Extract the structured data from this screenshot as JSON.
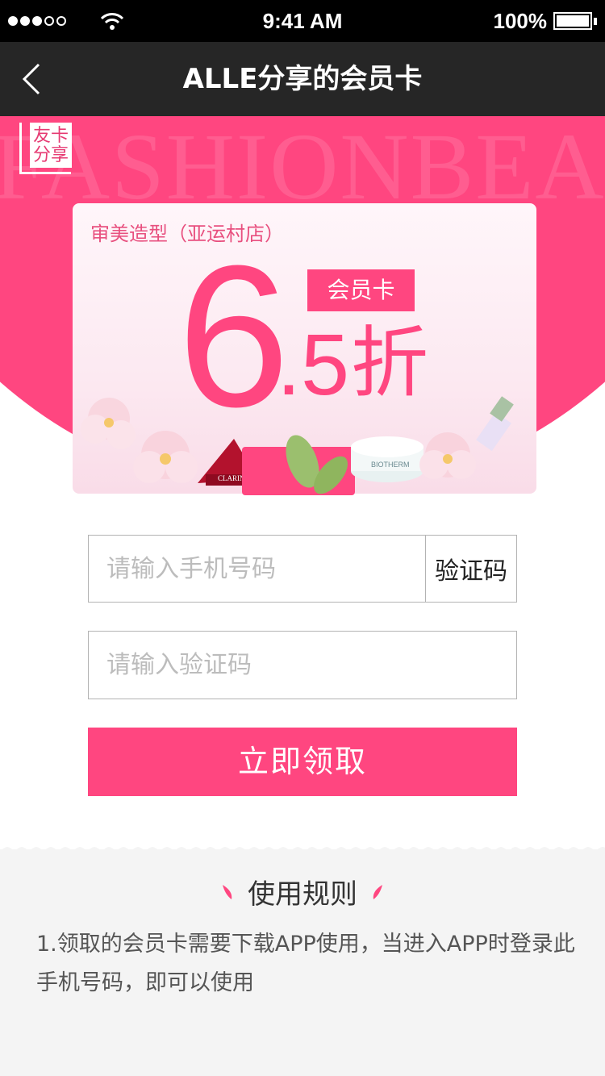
{
  "status_bar": {
    "time": "9:41 AM",
    "battery": "100%"
  },
  "nav": {
    "title": "ALLE分享的会员卡"
  },
  "hero": {
    "background_text": "FASHIONBEA",
    "badge_text": "友卡分享",
    "store_name": "审美造型（亚运村店）",
    "card_tag": "会员卡",
    "discount_big": "6",
    "discount_rest": ".5",
    "discount_unit": "折",
    "product_label_1": "CLARINS",
    "product_label_2": "BIOTHERM"
  },
  "form": {
    "phone_placeholder": "请输入手机号码",
    "get_code_label": "验证码",
    "code_placeholder": "请输入验证码",
    "submit_label": "立即领取"
  },
  "rules": {
    "title": "使用规则",
    "text": "1.领取的会员卡需要下载APP使用，当进入APP时登录此手机号码，即可以使用"
  },
  "colors": {
    "accent": "#ff4680",
    "nav_bg": "#262626",
    "rules_bg": "#f4f4f4"
  }
}
